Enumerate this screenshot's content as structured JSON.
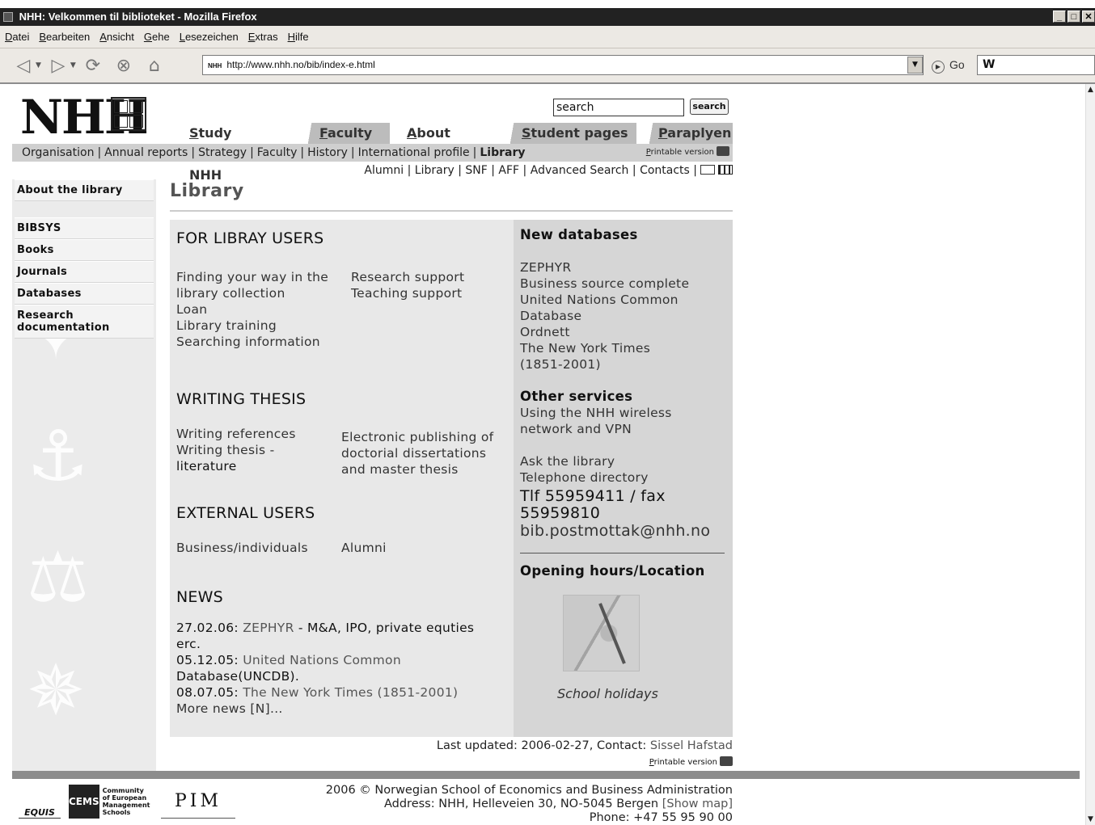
{
  "browser": {
    "title": "NHH: Velkommen til biblioteket - Mozilla Firefox",
    "window_controls": [
      "_",
      "□",
      "✕"
    ],
    "menu": [
      "Datei",
      "Bearbeiten",
      "Ansicht",
      "Gehe",
      "Lesezeichen",
      "Extras",
      "Hilfe"
    ],
    "url": "http://www.nhh.no/bib/index-e.html",
    "favicon_text": "NHH",
    "go_label": "Go",
    "search_engine_label": "W"
  },
  "header": {
    "logo_text": "NHH",
    "search_value": "search",
    "search_button": "search",
    "tabs": [
      "Study at NHH",
      "Faculty",
      "About NHH",
      "Student pages",
      "Paraplyen"
    ],
    "nav1": [
      "Organisation",
      "Annual reports",
      "Strategy",
      "Faculty",
      "History",
      "International profile",
      "Library"
    ],
    "printable": "Printable version",
    "nav2": [
      "Alumni",
      "Library",
      "SNF",
      "AFF",
      "Advanced Search",
      "Contacts"
    ]
  },
  "sidebar": {
    "items": [
      "About the library",
      "BIBSYS",
      "Books",
      "Journals",
      "Databases",
      "Research documentation"
    ]
  },
  "main": {
    "title": "Library",
    "users_head": "FOR LIBRAY USERS",
    "users_left": [
      "Finding your way in the library collection",
      "Loan",
      "Library training",
      "Searching information"
    ],
    "users_right": [
      "Research support",
      "Teaching support"
    ],
    "thesis_head": "WRITING THESIS",
    "thesis_left_1": "Writing references",
    "thesis_left_2": "Writing thesis -",
    "thesis_left_3": "literature",
    "thesis_right": "Electronic publishing of doctorial dissertations and master thesis",
    "external_head": "EXTERNAL USERS",
    "external_left": "Business/individuals",
    "external_right": "Alumni",
    "news_head": "NEWS",
    "news": [
      {
        "date": "27.02.06:",
        "link": "ZEPHYR",
        "rest": " - M&A, IPO, private equties erc."
      },
      {
        "date": "05.12.05:",
        "link": "United Nations Common",
        "rest": " Database(UNCDB)."
      },
      {
        "date": "08.07.05:",
        "link": "The New York Times (1851-2001)",
        "rest": ""
      }
    ],
    "more_news": "More news [N]..."
  },
  "right": {
    "new_db_head": "New databases",
    "databases": [
      "ZEPHYR",
      "Business source complete",
      "United Nations Common Database",
      "Ordnett",
      "The New York Times (1851-2001)"
    ],
    "other_head": "Other services",
    "wireless": "Using the NHH wireless network and VPN",
    "ask": "Ask the library",
    "phone_dir": "Telephone directory",
    "contact_line": "Tlf 55959411 / fax 55959810",
    "email": "bib.postmottak@nhh.no",
    "hours_head": "Opening hours/Location",
    "holidays": "School holidays"
  },
  "footer": {
    "updated_prefix": "Last updated: 2006-02-27, Contact: ",
    "contact_name": "Sissel Hafstad",
    "printable": "Printable version",
    "copyright": "2006 © Norwegian School of Economics and Business Administration",
    "address": "Address: NHH, Helleveien 30, NO-5045 Bergen",
    "show_map": "[Show map]",
    "phone": "Phone: +47 55 95 90 00",
    "logo_equis": "EQUIS",
    "logo_cems": "CEMS",
    "logo_cems_text": "Community of European Management Schools",
    "logo_pim": "PIM"
  }
}
